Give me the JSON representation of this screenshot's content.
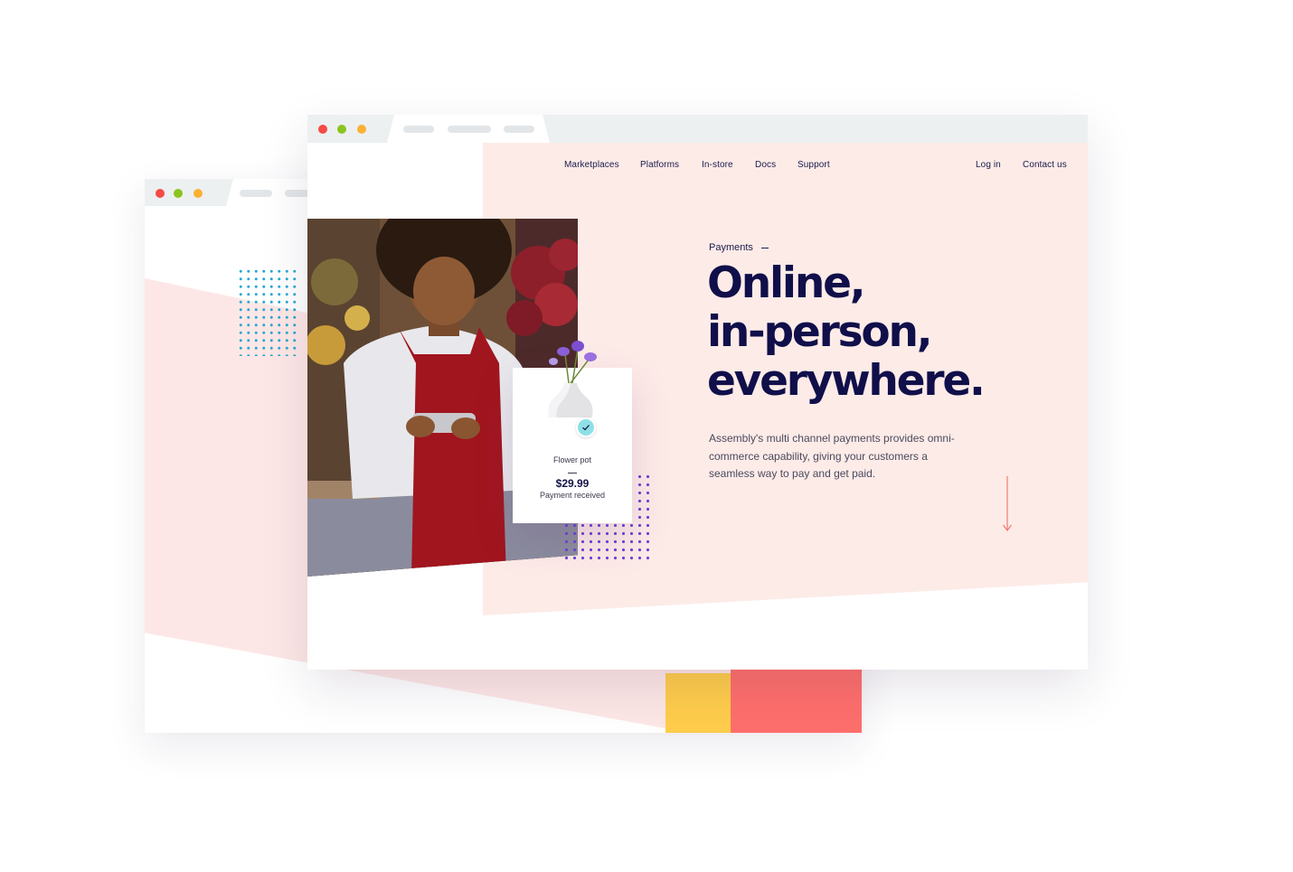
{
  "back_window": {
    "window_controls": [
      {
        "name": "close",
        "color": "#f44b45"
      },
      {
        "name": "minimize",
        "color": "#8bc41e"
      },
      {
        "name": "maximize",
        "color": "#fbb132"
      }
    ]
  },
  "front_window": {
    "window_controls": [
      {
        "name": "close",
        "color": "#f44b45"
      },
      {
        "name": "minimize",
        "color": "#8bc41e"
      },
      {
        "name": "maximize",
        "color": "#fbb132"
      }
    ],
    "nav": {
      "items": [
        "Marketplaces",
        "Platforms",
        "In-store",
        "Docs",
        "Support"
      ],
      "login": "Log in",
      "contact": "Contact us"
    },
    "hero": {
      "eyebrow": "Payments",
      "headline": [
        "Online,",
        "in-person,",
        "everywhere."
      ],
      "body": "Assembly's multi channel payments provides omni-commerce capability, giving your customers a seamless way to pay and get paid."
    },
    "product_card": {
      "name": "Flower pot",
      "price": "$29.99",
      "status": "Payment received"
    }
  },
  "colors": {
    "navy": "#100f4a",
    "pink_bg": "#fdebe8",
    "coral": "#fe6f6c",
    "yellow": "#ffcd4b",
    "teal": "#1fa9d0",
    "purple": "#6a3fd6"
  }
}
